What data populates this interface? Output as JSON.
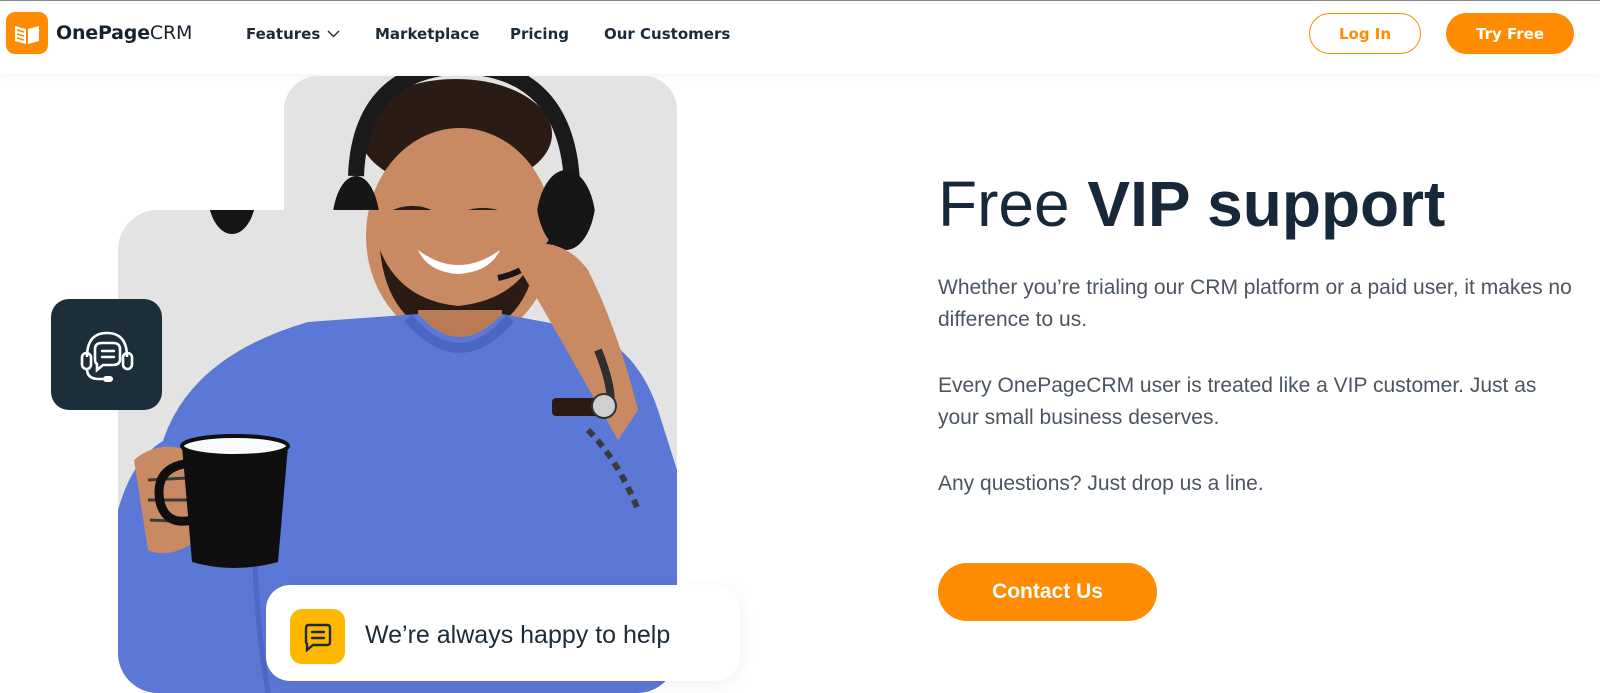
{
  "header": {
    "logo": {
      "bold": "OnePage",
      "light": "CRM",
      "icon": "onepagecrm-logo-icon"
    },
    "nav": [
      {
        "label": "Features",
        "has_dropdown": true
      },
      {
        "label": "Marketplace"
      },
      {
        "label": "Pricing"
      },
      {
        "label": "Our Customers"
      }
    ],
    "login_label": "Log In",
    "try_label": "Try Free"
  },
  "hero": {
    "title_light": "Free ",
    "title_bold": "VIP support",
    "paragraphs": [
      "Whether you’re trialing our CRM platform or a paid user, it makes no difference to us.",
      "Every OnePageCRM user is treated like a VIP customer. Just as your small business deserves.",
      "Any questions? Just drop us a line."
    ],
    "contact_label": "Contact Us"
  },
  "image_card": {
    "badge_icon": "headset-support-icon",
    "help_icon": "chat-bubble-icon",
    "help_text": "We’re always happy to help"
  },
  "colors": {
    "accent": "#ff8c00",
    "badge_dark": "#1d2e3b",
    "chat_yellow": "#ffb800",
    "heading": "#17283a",
    "body_text": "#4b5561",
    "sweater_blue": "#5b78d6"
  }
}
